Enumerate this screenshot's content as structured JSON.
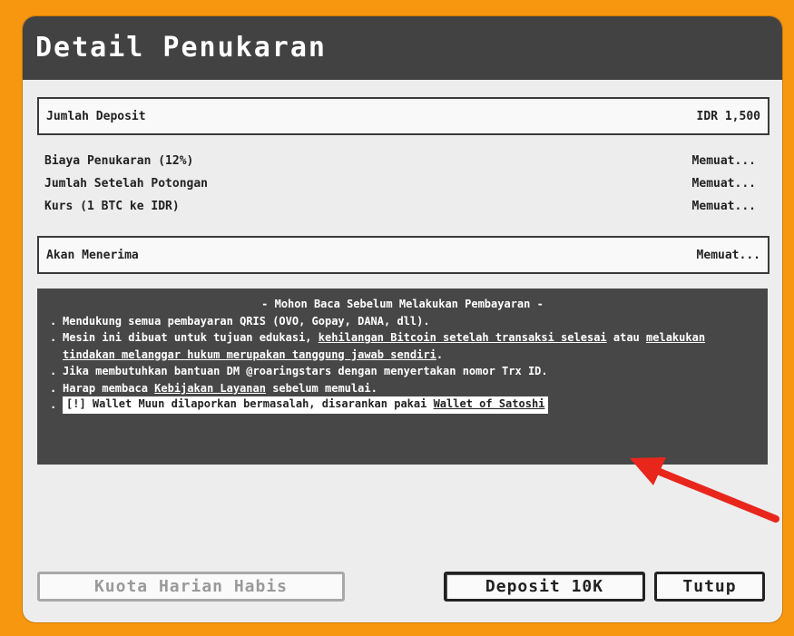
{
  "modal": {
    "title": "Detail Penukaran",
    "deposit": {
      "label": "Jumlah Deposit",
      "value": "IDR 1,500"
    },
    "rows": [
      {
        "label": "Biaya Penukaran (12%)",
        "value": "Memuat..."
      },
      {
        "label": "Jumlah Setelah Potongan",
        "value": "Memuat..."
      },
      {
        "label": "Kurs (1 BTC ke IDR)",
        "value": "Memuat..."
      }
    ],
    "receive": {
      "label": "Akan Menerima",
      "value": "Memuat..."
    },
    "notice": {
      "title": "- Mohon Baca Sebelum Melakukan Pembayaran -",
      "bullet": ".",
      "l1": "Mendukung semua pembayaran QRIS (OVO, Gopay, DANA, dll).",
      "l2a": "Mesin ini dibuat untuk tujuan edukasi, ",
      "l2b": "kehilangan Bitcoin setelah transaksi selesai",
      "l2c": " atau ",
      "l2d": "melakukan tindakan melanggar hukum merupakan tanggung jawab sendiri",
      "l2e": ".",
      "l3": "Jika membutuhkan bantuan DM @roaringstars dengan menyertakan nomor Trx ID.",
      "l4a": "Harap membaca ",
      "l4b": "Kebijakan Layanan",
      "l4c": " sebelum memulai.",
      "l5a": "[!] Wallet Muun dilaporkan bermasalah, disarankan pakai ",
      "l5b": "Wallet of Satoshi"
    },
    "buttons": {
      "quota": "Kuota Harian Habis",
      "deposit": "Deposit 10K",
      "close": "Tutup"
    }
  },
  "colors": {
    "background": "#f7960f",
    "header": "#424242",
    "arrow": "#e8261c"
  }
}
